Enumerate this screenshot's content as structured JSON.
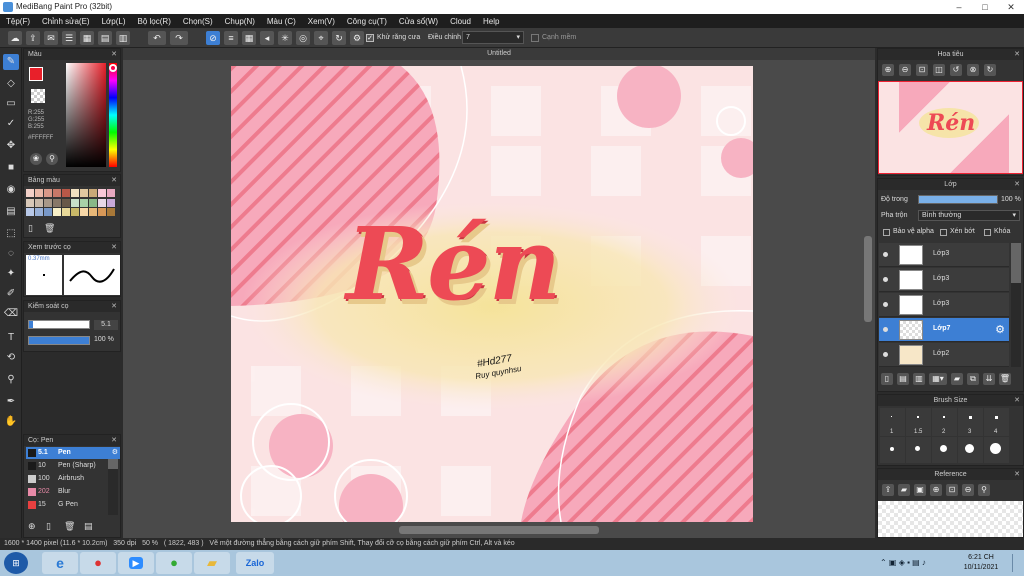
{
  "window": {
    "title": "MediBang Paint Pro (32bit)"
  },
  "menu": [
    "Tệp(F)",
    "Chỉnh sửa(E)",
    "Lớp(L)",
    "Bộ lọc(R)",
    "Chọn(S)",
    "Chụp(N)",
    "Màu (C)",
    "Xem(V)",
    "Công cụ(T)",
    "Cửa sổ(W)",
    "Cloud",
    "Help"
  ],
  "toolbar": {
    "antialias_label": "Khử răng cưa",
    "adjust_label": "Điều chỉnh",
    "adjust_value": "7",
    "edge_label": "Cạnh mềm"
  },
  "color_panel": {
    "title": "Màu",
    "r": "R:255",
    "g": "G:255",
    "b": "B:255",
    "hex": "#FFFFFF"
  },
  "palette_panel": {
    "title": "Bảng màu"
  },
  "preview_panel": {
    "title": "Xem trước cọ",
    "size": "0.37mm"
  },
  "brush_control": {
    "title": "Kiểm soát cọ",
    "size": "5.1",
    "opacity": "100 %"
  },
  "brush_panel": {
    "title": "Cọ: Pen",
    "items": [
      {
        "size": "5.1",
        "name": "Pen",
        "color": "#1a1a1a"
      },
      {
        "size": "10",
        "name": "Pen (Sharp)",
        "color": "#1a1a1a"
      },
      {
        "size": "100",
        "name": "Airbrush",
        "color": "#cccccc"
      },
      {
        "size": "202",
        "name": "Blur",
        "color": "#e88aa8"
      },
      {
        "size": "15",
        "name": "G Pen",
        "color": "#e84040"
      }
    ]
  },
  "document": {
    "tab": "Untitled",
    "title_text": "Rén",
    "tag1": "#Hd277",
    "tag2": "Ruy quynhsu"
  },
  "navigator": {
    "title": "Hoa tiêu"
  },
  "layer_panel": {
    "title": "Lớp",
    "opacity_label": "Độ trong",
    "opacity_value": "100 %",
    "opacity_fraction": 1.0,
    "blend_label": "Pha trộn",
    "blend_value": "Bình thường",
    "protect_alpha": "Bảo vệ alpha",
    "clip": "Xén bớt",
    "lock": "Khóa",
    "layers": [
      {
        "name": "Lớp3",
        "selected": false
      },
      {
        "name": "Lớp3",
        "selected": false
      },
      {
        "name": "Lớp3",
        "selected": false
      },
      {
        "name": "Lớp7",
        "selected": true
      },
      {
        "name": "Lớp2",
        "selected": false
      }
    ]
  },
  "brush_size_panel": {
    "title": "Brush Size",
    "sizes": [
      "1",
      "1.5",
      "2",
      "3",
      "4"
    ]
  },
  "reference_panel": {
    "title": "Reference"
  },
  "status": {
    "dimensions": "1600 * 1400 pixel",
    "cm": "(11.6 * 10.2cm)",
    "dpi": "350 dpi",
    "zoom": "50 %",
    "coords": "( 1822, 483 )",
    "hint": "Vẽ một đường thẳng bằng cách giữ phím Shift, Thay đổi cỡ cọ bằng cách giữ phím Ctrl, Alt và kéo"
  },
  "taskbar": {
    "time": "6:21 CH",
    "date": "10/11/2021",
    "zalo": "Zalo"
  },
  "colors": {
    "accent": "#3d7fd4",
    "pink": "#f5a8bc",
    "red": "#e8474f"
  }
}
